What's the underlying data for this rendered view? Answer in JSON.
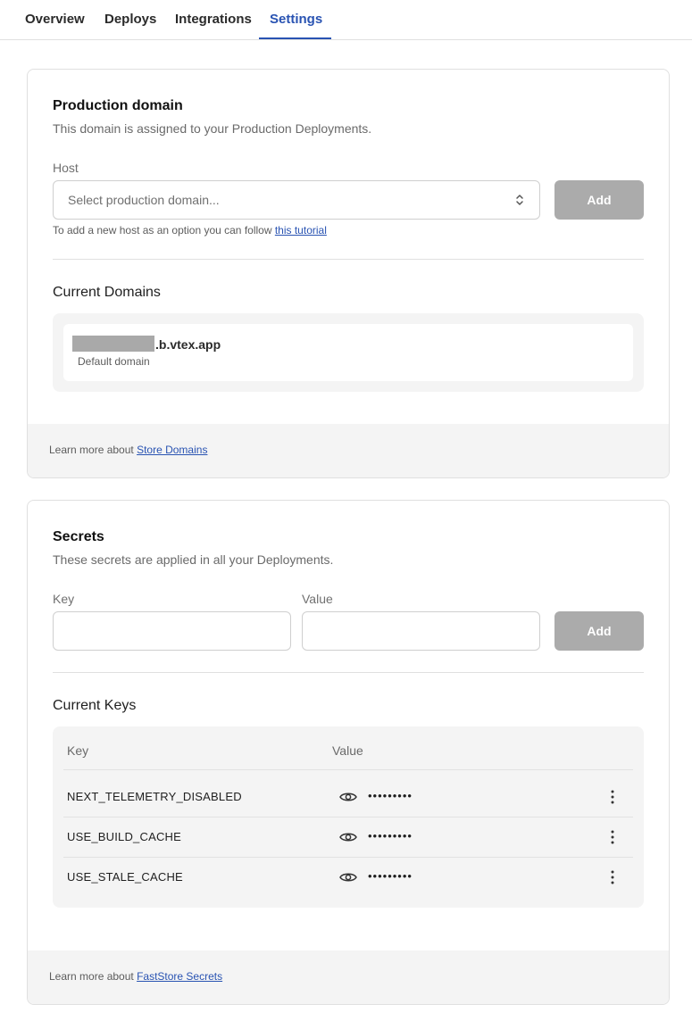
{
  "tabs": [
    {
      "label": "Overview"
    },
    {
      "label": "Deploys"
    },
    {
      "label": "Integrations"
    },
    {
      "label": "Settings",
      "active": true
    }
  ],
  "production_domain": {
    "title": "Production domain",
    "description": "This domain is assigned to your Production Deployments.",
    "host_label": "Host",
    "select_placeholder": "Select production domain...",
    "add_label": "Add",
    "helper_prefix": "To add a new host as an option you can follow",
    "helper_link": "this tutorial",
    "current_title": "Current Domains",
    "domains": [
      {
        "name_suffix": ".b.vtex.app",
        "subtitle": "Default domain"
      }
    ],
    "footer_prefix": "Learn more about",
    "footer_link": "Store Domains"
  },
  "secrets": {
    "title": "Secrets",
    "description": "These secrets are applied in all your Deployments.",
    "key_label": "Key",
    "value_label": "Value",
    "add_label": "Add",
    "current_title": "Current Keys",
    "table_headers": {
      "key": "Key",
      "value": "Value"
    },
    "rows": [
      {
        "key": "NEXT_TELEMETRY_DISABLED",
        "value_mask": "•••••••••"
      },
      {
        "key": "USE_BUILD_CACHE",
        "value_mask": "•••••••••"
      },
      {
        "key": "USE_STALE_CACHE",
        "value_mask": "•••••••••"
      }
    ],
    "footer_prefix": "Learn more about",
    "footer_link": "FastStore Secrets"
  },
  "colors": {
    "accent": "#2953b2",
    "button_disabled": "#ababab",
    "panel_bg": "#f4f4f4"
  },
  "icons": {
    "select": "chevron-up-down-icon",
    "show_value": "eye-icon",
    "row_menu": "more-vertical-icon"
  }
}
